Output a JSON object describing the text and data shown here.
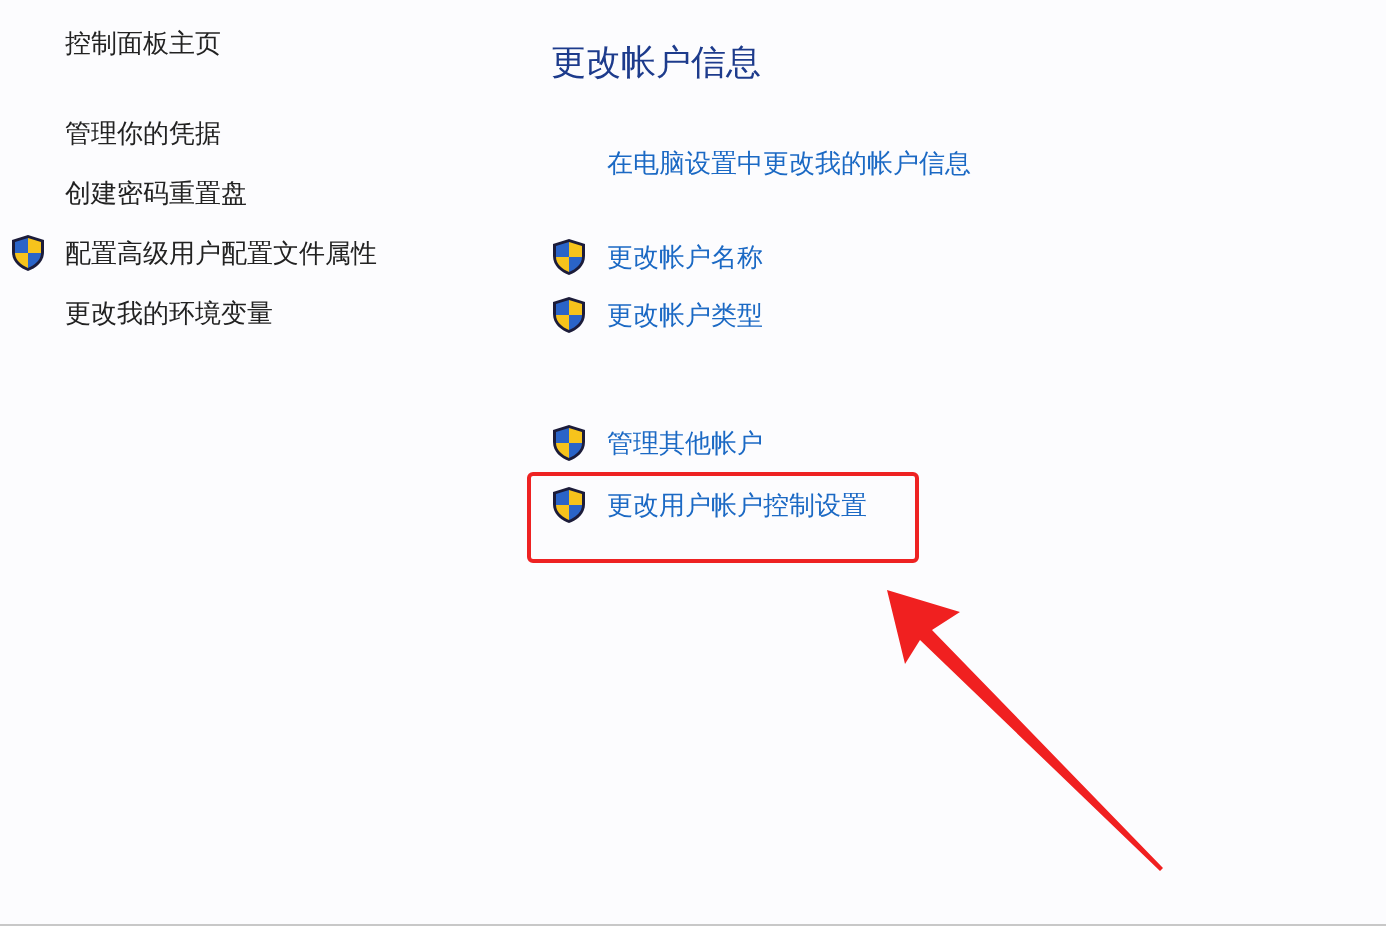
{
  "sidebar": {
    "items": [
      {
        "label": "控制面板主页",
        "shield": false
      },
      {
        "label": "管理你的凭据",
        "shield": false
      },
      {
        "label": "创建密码重置盘",
        "shield": false
      },
      {
        "label": "配置高级用户配置文件属性",
        "shield": true
      },
      {
        "label": "更改我的环境变量",
        "shield": false
      }
    ]
  },
  "main": {
    "title": "更改帐户信息",
    "groups": [
      {
        "links": [
          {
            "label": "在电脑设置中更改我的帐户信息",
            "shield": false,
            "highlighted": false
          }
        ]
      },
      {
        "links": [
          {
            "label": "更改帐户名称",
            "shield": true,
            "highlighted": false
          },
          {
            "label": "更改帐户类型",
            "shield": true,
            "highlighted": false
          }
        ]
      },
      {
        "links": [
          {
            "label": "管理其他帐户",
            "shield": true,
            "highlighted": false
          },
          {
            "label": "更改用户帐户控制设置",
            "shield": true,
            "highlighted": true
          }
        ]
      }
    ]
  }
}
